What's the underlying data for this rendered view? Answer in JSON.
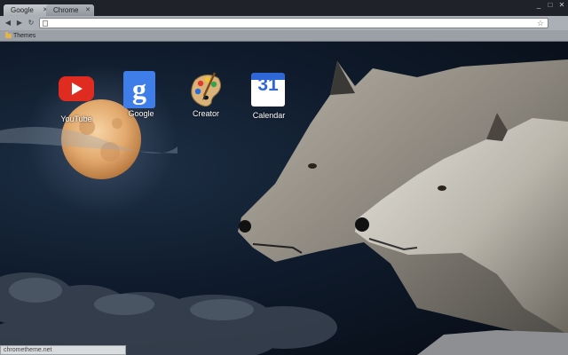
{
  "tabs": [
    {
      "label": "Google",
      "active": true
    },
    {
      "label": "Chrome",
      "active": false
    }
  ],
  "window_controls": {
    "minimize": "_",
    "maximize": "□",
    "close": "✕"
  },
  "toolbar": {
    "back": "◀",
    "forward": "▶",
    "reload": "↻",
    "omnibox_value": "",
    "star": "☆"
  },
  "bookmarks": [
    {
      "label": "Themes",
      "icon": "folder-icon"
    }
  ],
  "apps": [
    {
      "label": "YouTube",
      "icon": "youtube-icon"
    },
    {
      "label": "Google",
      "icon": "google-search-icon"
    },
    {
      "label": "Creator",
      "icon": "theme-creator-palette-icon"
    },
    {
      "label": "Calendar",
      "icon": "calendar-icon",
      "icon_text": "31"
    }
  ],
  "status_bar": {
    "text": "chrometheme.net"
  },
  "colors": {
    "tabstrip": "#1f2329",
    "toolbar": "#aab0b6",
    "bookmarks_bar": "#9aa0a6",
    "sky": "#0f1b2c",
    "moon": "#e7b27a",
    "youtube_red": "#e02b20",
    "google_blue": "#3f7ee8",
    "calendar_blue": "#2f67d6"
  }
}
